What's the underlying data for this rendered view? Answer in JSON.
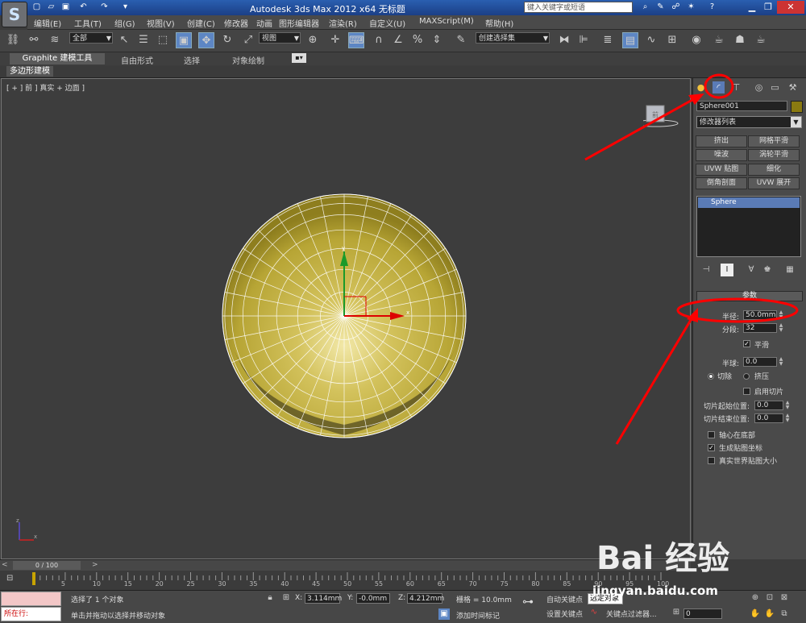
{
  "title_bar": {
    "title": "Autodesk 3ds Max  2012 x64     无标题",
    "search_placeholder": "键入关键字或短语",
    "help": "?"
  },
  "menu": [
    "编辑(E)",
    "工具(T)",
    "组(G)",
    "视图(V)",
    "创建(C)",
    "修改器",
    "动画",
    "图形编辑器",
    "渲染(R)",
    "自定义(U)",
    "MAXScript(M)",
    "帮助(H)"
  ],
  "toolbar": {
    "selection_filter": "全部",
    "ref_coord": "视图",
    "named_selection": "创建选择集"
  },
  "ribbon": {
    "tabs": [
      "Graphite 建模工具",
      "自由形式",
      "选择",
      "对象绘制"
    ],
    "panel_label": "多边形建模"
  },
  "viewport": {
    "label": "[ + ] 前 ] 真实 + 边面 ]",
    "viewcube_label": "前"
  },
  "command_panel": {
    "object_name": "Sphere001",
    "modifier_list": "修改器列表",
    "modifier_buttons": [
      "挤出",
      "网格平滑",
      "噪波",
      "涡轮平滑",
      "UVW 贴图",
      "细化",
      "倒角剖面",
      "UVW 展开"
    ],
    "stack_item": "Sphere",
    "rollout_title": "参数",
    "params": {
      "radius_label": "半径:",
      "radius_value": "50.0mm",
      "segments_label": "分段:",
      "segments_value": "32",
      "smooth_label": "平滑",
      "hemisphere_label": "半球:",
      "hemisphere_value": "0.0",
      "chop_label": "切除",
      "squash_label": "挤压",
      "slice_on_label": "启用切片",
      "slice_from_label": "切片起始位置:",
      "slice_from_value": "0.0",
      "slice_to_label": "切片结束位置:",
      "slice_to_value": "0.0",
      "base_to_pivot_label": "轴心在底部",
      "gen_map_label": "生成贴图坐标",
      "real_world_label": "真实世界贴图大小"
    }
  },
  "timeline": {
    "slider_label": "0 / 100",
    "ticks": [
      "5",
      "10",
      "15",
      "20",
      "25",
      "30",
      "35",
      "40",
      "45",
      "50",
      "55",
      "60",
      "65",
      "70",
      "75",
      "80",
      "85",
      "90",
      "95",
      "100"
    ]
  },
  "status": {
    "running_label": "所在行:",
    "selected": "选择了 1 个对象",
    "prompt": "单击并拖动以选择并移动对象",
    "x_label": "X:",
    "x_value": "3.114mm",
    "y_label": "Y:",
    "y_value": "-0.0mm",
    "z_label": "Z:",
    "z_value": "4.212mm",
    "grid": "栅格 = 10.0mm",
    "add_time_tag": "添加时间标记",
    "auto_key": "自动关键点",
    "set_key": "设置关键点",
    "selected_object": "选定对象",
    "key_filters": "关键点过滤器...",
    "frame": "0"
  },
  "watermark": {
    "brand": "Bai 经验",
    "url": "jingyan.baidu.com"
  },
  "colors": {
    "sphere": "#b8a636",
    "annotation": "#ff0000",
    "selection_blue": "#5a7bb6"
  }
}
